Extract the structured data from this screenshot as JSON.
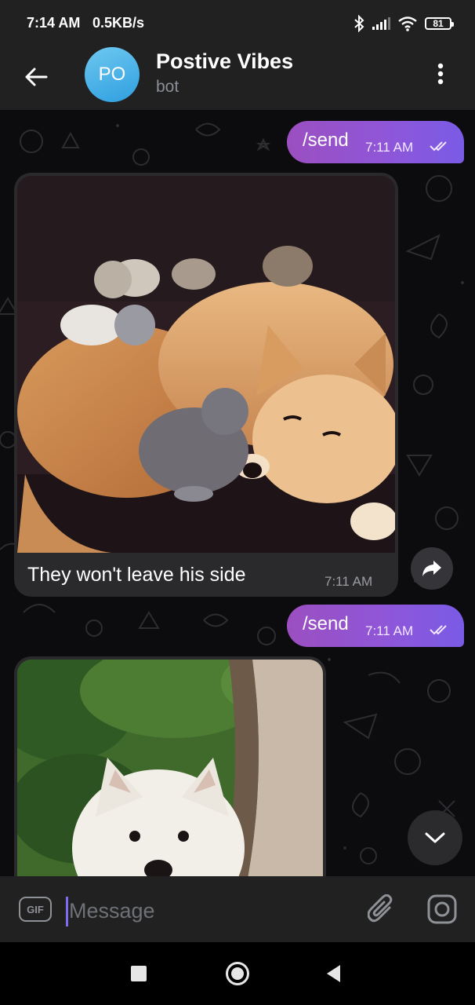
{
  "status_bar": {
    "time": "7:14 AM",
    "speed": "0.5KB/s",
    "battery": "81",
    "icons": [
      "bluetooth-icon",
      "signal-icon",
      "wifi-icon",
      "battery-icon"
    ]
  },
  "header": {
    "avatar_initials": "PO",
    "title": "Postive Vibes",
    "subtitle": "bot",
    "avatar_color": "#3ba5e3"
  },
  "messages": [
    {
      "type": "outgoing",
      "text": "/send",
      "time": "7:11 AM",
      "status": "read"
    },
    {
      "type": "incoming_photo",
      "caption": "They won't leave his side",
      "time": "7:11 AM",
      "image": "dog with kittens"
    },
    {
      "type": "outgoing",
      "text": "/send",
      "time": "7:11 AM",
      "status": "read"
    },
    {
      "type": "incoming_photo",
      "caption": "",
      "time": "",
      "image": "white fluffy dog"
    }
  ],
  "input_bar": {
    "gif_label": "GIF",
    "placeholder": "Message"
  },
  "colors": {
    "outgoing_bubble": "#8f56d8",
    "incoming_bubble": "#2a2a2c",
    "header_bg": "#212121",
    "chat_bg": "#0c0c0e"
  }
}
